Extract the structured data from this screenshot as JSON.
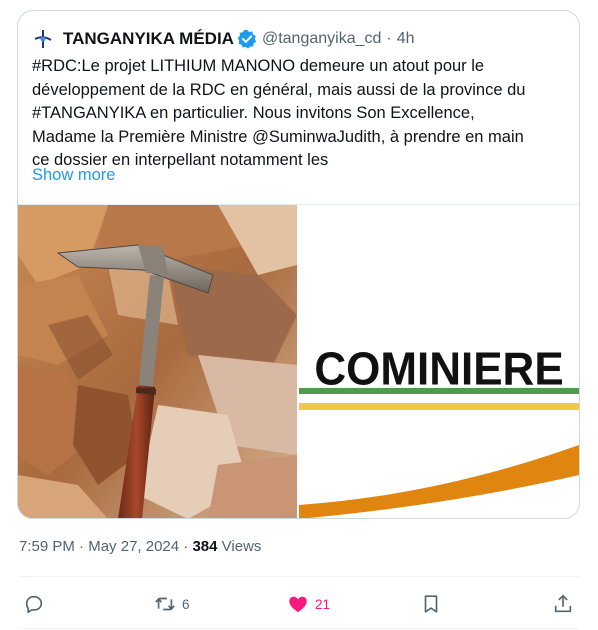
{
  "tweet": {
    "author_name": "TANGANYIKA MÉDIA",
    "handle": "@tanganyika_cd",
    "separator": "·",
    "age": "4h",
    "text": "#RDC:Le projet LITHIUM MANONO demeure un atout pour le\ndéveloppement de la RDC en général, mais aussi de la province du\n#TANGANYIKA en particulier. Nous invitons Son Excellence,\nMadame la Première Ministre @SuminwaJudith, à prendre en main\nce dossier en interpellant notamment les",
    "show_more": "Show more"
  },
  "media": {
    "right_image_text": "COMINIERE"
  },
  "meta": {
    "time": "7:59 PM",
    "sep1": "·",
    "date": "May 27, 2024",
    "sep2": "·",
    "views_count": "384",
    "views_label": "Views"
  },
  "actions": {
    "reply_count": "",
    "retweet_count": "6",
    "like_count": "21",
    "like_color": "#f91880",
    "icons": [
      "reply-icon",
      "retweet-icon",
      "heart-icon",
      "bookmark-icon",
      "share-icon"
    ]
  },
  "colors": {
    "link": "#1d9bf0",
    "muted": "#536471",
    "verified": "#1d9bf0",
    "cominiere_orange": "#e0850f",
    "cominiere_green": "#2e8b2e"
  }
}
